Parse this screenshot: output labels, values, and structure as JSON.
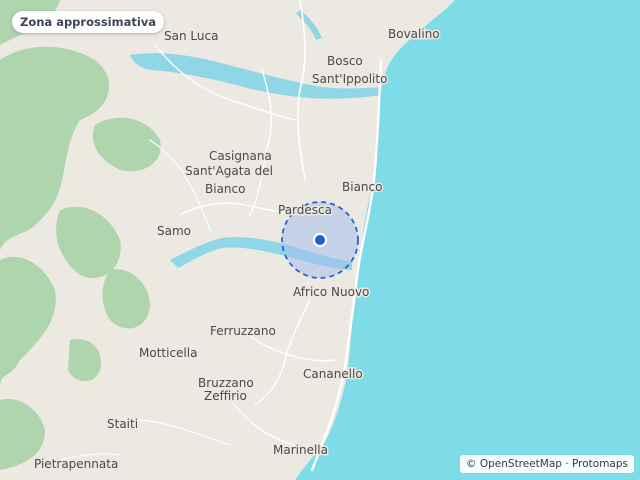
{
  "badge": {
    "label": "Zona approssimativa"
  },
  "attribution": {
    "osm": "© OpenStreetMap",
    "sep": "·",
    "protomaps": "Protomaps"
  },
  "colors": {
    "sea": "#7ddce8",
    "land": "#ece8e2",
    "forest": "#a9d3a8",
    "river": "#8fd6e6",
    "road": "#ffffff",
    "accuracy_fill": "#a8c0ec",
    "accuracy_stroke": "#2a62d4",
    "marker": "#1f5fd6"
  },
  "places": [
    "San Luca",
    "Bovalino",
    "Bosco",
    "Sant'Ippolito",
    "Casignana",
    "Sant'Agata del",
    "Bianco",
    "Bianco",
    "Pardesca",
    "Samo",
    "Africo Nuovo",
    "Ferruzzano",
    "Motticella",
    "Cananello",
    "Bruzzano",
    "Zeffirio",
    "Staiti",
    "Marinella",
    "Pietrapennata"
  ],
  "marker": {
    "name": "approximate-location"
  }
}
